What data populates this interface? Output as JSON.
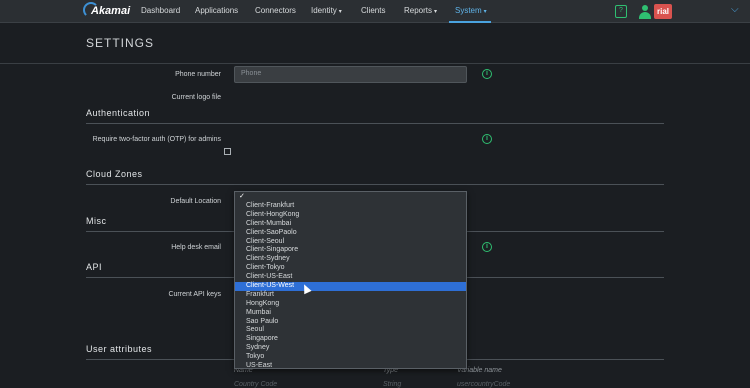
{
  "nav": {
    "logo_text": "Akamai",
    "items": [
      {
        "label": "Dashboard",
        "caret": ""
      },
      {
        "label": "Applications",
        "caret": ""
      },
      {
        "label": "Connectors",
        "caret": ""
      },
      {
        "label": "Identity",
        "caret": "▾"
      },
      {
        "label": "Clients",
        "caret": ""
      },
      {
        "label": "Reports",
        "caret": "▾"
      },
      {
        "label": "System",
        "caret": "▾"
      }
    ],
    "active_item": "System",
    "trial_badge": "rial",
    "clip_icon_glyph": "?"
  },
  "page": {
    "title": "SETTINGS"
  },
  "settings": {
    "phone_label": "Phone number",
    "phone_placeholder": "Phone",
    "logo_label": "Current logo file",
    "auth_title": "Authentication",
    "otp_label": "Require two-factor auth (OTP) for admins",
    "cloud_title": "Cloud Zones",
    "default_location_label": "Default Location",
    "misc_title": "Misc",
    "helpdesk_label": "Help desk email",
    "api_title": "API",
    "api_keys_label": "Current API keys",
    "user_attr_title": "User attributes",
    "columns": {
      "name": "Name",
      "type": "Type",
      "variable": "Variable name"
    },
    "ghost_row": {
      "name": "Country Code",
      "type": "String",
      "variable": "usercountryCode"
    }
  },
  "dropdown": {
    "checkmark": "✓",
    "selected": "Client-US-West",
    "options": [
      "Client-Frankfurt",
      "Client-HongKong",
      "Client-Mumbai",
      "Client-SaoPaolo",
      "Client-Seoul",
      "Client-Singapore",
      "Client-Sydney",
      "Client-Tokyo",
      "Client-US-East",
      "Client-US-West",
      "Frankfurt",
      "HongKong",
      "Mumbai",
      "Sao Paulo",
      "Seoul",
      "Singapore",
      "Sydney",
      "Tokyo",
      "US-East"
    ]
  },
  "icons": {
    "info": "i",
    "colors": {
      "accent_green": "#2fbf71",
      "accent_blue": "#4aa3df",
      "selection": "#2e6fd6",
      "badge_red": "#d9534f"
    }
  }
}
